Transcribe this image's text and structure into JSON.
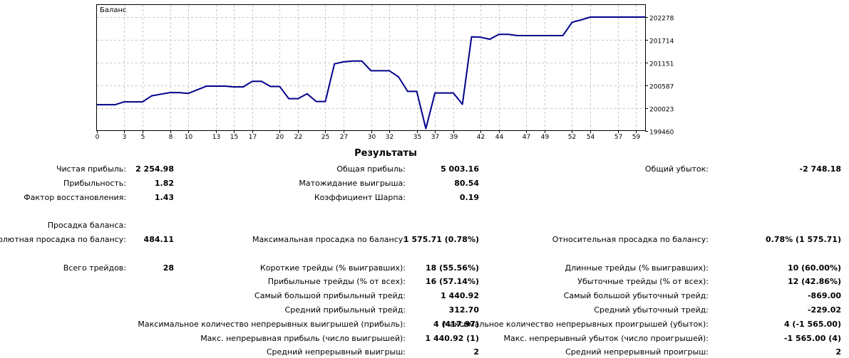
{
  "chart_data": {
    "type": "line",
    "title": "Баланс",
    "x_ticks": [
      "0",
      "3",
      "5",
      "8",
      "10",
      "13",
      "15",
      "17",
      "20",
      "22",
      "25",
      "27",
      "30",
      "32",
      "35",
      "37",
      "39",
      "42",
      "44",
      "47",
      "49",
      "52",
      "54",
      "57",
      "59"
    ],
    "y_ticks": [
      "202278",
      "201714",
      "201151",
      "200587",
      "200023",
      "199460"
    ],
    "ylim": [
      199460,
      202278
    ],
    "xlim": [
      0,
      60
    ],
    "grid": true,
    "line_color": "#00008b",
    "series": [
      {
        "x": [
          0,
          1,
          2,
          3,
          4,
          5,
          6,
          7,
          8,
          9,
          10,
          11,
          12,
          13,
          14,
          15,
          16,
          17,
          18,
          19,
          20,
          21,
          22,
          23,
          24,
          25,
          26,
          27,
          28,
          29,
          30,
          31,
          32,
          33,
          34,
          35,
          36,
          37,
          38,
          39,
          40,
          41,
          42,
          43,
          44,
          45,
          46,
          47,
          48,
          49,
          50,
          51,
          52,
          53,
          54,
          55,
          56,
          57,
          58,
          59,
          60
        ],
        "values": [
          200110,
          200110,
          200110,
          200180,
          200180,
          200180,
          200330,
          200370,
          200410,
          200410,
          200390,
          200480,
          200570,
          200570,
          200570,
          200550,
          200550,
          200690,
          200690,
          200560,
          200560,
          200260,
          200260,
          200380,
          200190,
          200190,
          201120,
          201170,
          201190,
          201190,
          200950,
          200950,
          200950,
          200800,
          200440,
          200440,
          199520,
          200400,
          200400,
          200400,
          200120,
          201790,
          201780,
          201730,
          201850,
          201850,
          201820,
          201820,
          201820,
          201820,
          201820,
          201820,
          202150,
          202210,
          202278,
          202278,
          202278,
          202278,
          202278,
          202278,
          202278
        ]
      }
    ]
  },
  "results": {
    "title": "Результаты",
    "rows": [
      {
        "l1": "Чистая прибыль:",
        "v1": "2 254.98",
        "l2": "Общая прибыль:",
        "v2": "5 003.16",
        "l3": "Общий убыток:",
        "v3": "-2 748.18"
      },
      {
        "l1": "Прибыльность:",
        "v1": "1.82",
        "l2": "Матожидание выигрыша:",
        "v2": "80.54",
        "l3": "",
        "v3": ""
      },
      {
        "l1": "Фактор восстановления:",
        "v1": "1.43",
        "l2": "Коэффициент Шарпа:",
        "v2": "0.19",
        "l3": "",
        "v3": ""
      },
      {
        "l1": "",
        "v1": "",
        "l2": "",
        "v2": "",
        "l3": "",
        "v3": ""
      },
      {
        "l1": "Просадка баланса:",
        "v1": "",
        "l2": "",
        "v2": "",
        "l3": "",
        "v3": ""
      },
      {
        "l1": "Абсолютная просадка по балансу:",
        "v1": "484.11",
        "l2": "Максимальная просадка по балансу:",
        "v2": "1 575.71 (0.78%)",
        "l3": "Относительная просадка по балансу:",
        "v3": "0.78% (1 575.71)"
      },
      {
        "l1": "",
        "v1": "",
        "l2": "",
        "v2": "",
        "l3": "",
        "v3": ""
      },
      {
        "l1": "Всего трейдов:",
        "v1": "28",
        "l2": "Короткие трейды (% выигравших):",
        "v2": "18 (55.56%)",
        "l3": "Длинные трейды (% выигравших):",
        "v3": "10 (60.00%)"
      },
      {
        "l1": "",
        "v1": "",
        "l2": "Прибыльные трейды (% от всех):",
        "v2": "16 (57.14%)",
        "l3": "Убыточные трейды (% от всех):",
        "v3": "12 (42.86%)"
      },
      {
        "l1": "",
        "v1": "",
        "l2": "Самый большой прибыльный трейд:",
        "v2": "1 440.92",
        "l3": "Самый большой убыточный трейд:",
        "v3": "-869.00"
      },
      {
        "l1": "",
        "v1": "",
        "l2": "Средний прибыльный трейд:",
        "v2": "312.70",
        "l3": "Средний убыточный трейд:",
        "v3": "-229.02"
      },
      {
        "l1": "",
        "v1": "",
        "l2": "Максимальное количество непрерывных выигрышей (прибыль):",
        "v2": "4 (417.97)",
        "l3": "Максимальное количество непрерывных проигрышей (убыток):",
        "v3": "4 (-1 565.00)"
      },
      {
        "l1": "",
        "v1": "",
        "l2": "Макс. непрерывная прибыль (число выигрышей):",
        "v2": "1 440.92 (1)",
        "l3": "Макс. непрерывный убыток (число проигрышей):",
        "v3": "-1 565.00 (4)"
      },
      {
        "l1": "",
        "v1": "",
        "l2": "Средний непрерывный выигрыш:",
        "v2": "2",
        "l3": "Средний непрерывный проигрыш:",
        "v3": "2"
      }
    ]
  }
}
